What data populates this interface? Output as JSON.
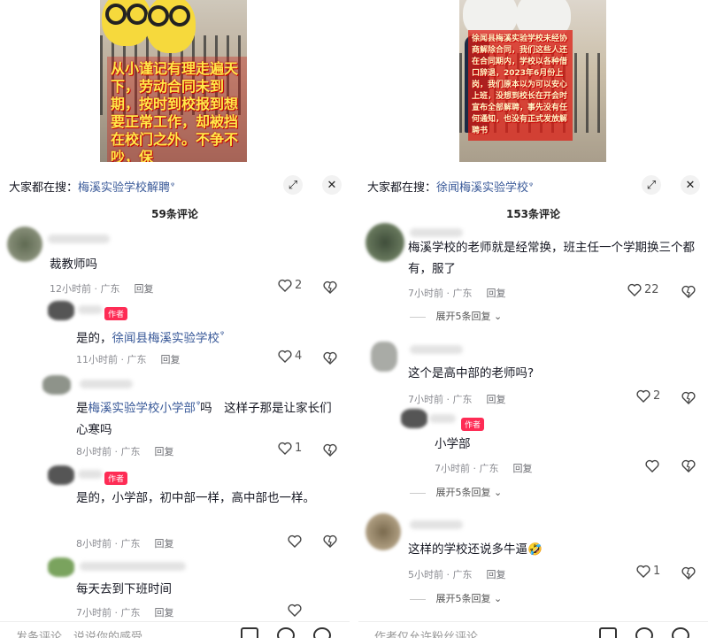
{
  "left": {
    "video": {
      "caption": "从小谨记有理走遍天下，劳动合同未到期，按时到校报到想要正常工作，却被挡在校门之外。不争不吵，保"
    },
    "search": {
      "prefix": "大家都在搜：",
      "term": "梅溪实验学校解聘"
    },
    "comment_count": "59条评论",
    "comments": [
      {
        "text": "裁教师吗",
        "time": "12小时前 · 广东",
        "reply": "回复",
        "likes": "2"
      },
      {
        "author_badge": "作者",
        "text_prefix": "是的，",
        "link": "徐闻县梅溪实验学校",
        "time": "11小时前 · 广东",
        "reply": "回复",
        "likes": "4"
      },
      {
        "text_prefix": "是",
        "link": "梅溪实验学校小学部",
        "text_suffix": "吗　这样子那是让家长们心寒吗",
        "time": "8小时前 · 广东",
        "reply": "回复",
        "likes": "1"
      },
      {
        "author_badge": "作者",
        "text": "是的，小学部，初中部一样，高中部也一样。",
        "time": "8小时前 · 广东",
        "reply": "回复"
      },
      {
        "text": "每天去到下班时间",
        "time": "7小时前 · 广东",
        "reply": "回复"
      }
    ],
    "input_placeholder": "发条评论，说说你的感受"
  },
  "right": {
    "video": {
      "caption": "徐闻县梅溪实验学校未经协商解除合同，我们这些人还在合同期内，学校以各种借口辞退，2023年6月份上岗，我们原本以为可以安心上班，没想到校长在开会时宣布全部解聘，事先没有任何通知，也没有正式发放解聘书"
    },
    "search": {
      "prefix": "大家都在搜：",
      "term": "徐闻梅溪实验学校"
    },
    "comment_count": "153条评论",
    "comments": [
      {
        "text": "梅溪学校的老师就是经常换，班主任一个学期换三个都有，服了",
        "time": "7小时前 · 广东",
        "reply": "回复",
        "likes": "22",
        "expand": "展开5条回复"
      },
      {
        "text": "这个是高中部的老师吗?",
        "time": "7小时前 · 广东",
        "reply": "回复",
        "likes": "2"
      },
      {
        "author_badge": "作者",
        "text": "小学部",
        "time": "7小时前 · 广东",
        "reply": "回复",
        "expand": "展开5条回复"
      },
      {
        "text": "这样的学校还说多牛逼",
        "emoji": "🤣",
        "time": "5小时前 · 广东",
        "reply": "回复",
        "likes": "1",
        "expand": "展开5条回复"
      }
    ],
    "input_placeholder": "作者仅允许粉丝评论"
  },
  "icons": {
    "expand_chevron": "⌄",
    "collapse": "⤢",
    "close": "✕"
  }
}
